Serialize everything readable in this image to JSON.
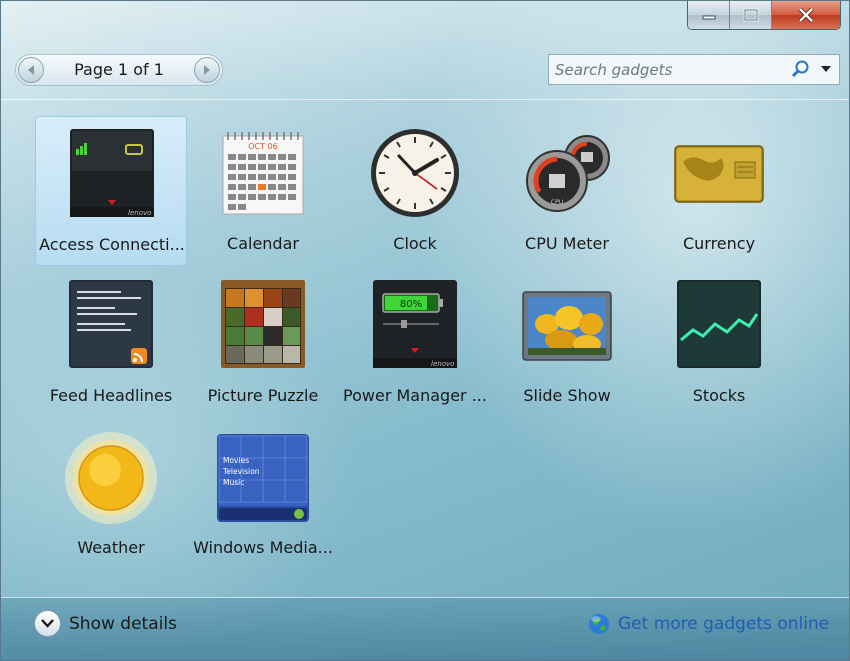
{
  "window_controls": {
    "minimize_glyph": "▁",
    "maximize_glyph": "▢",
    "close_glyph": "✕"
  },
  "pager": {
    "label": "Page 1 of 1",
    "prev_icon": "chevron-left-icon",
    "next_icon": "chevron-right-icon"
  },
  "search": {
    "placeholder": "Search gadgets",
    "icon": "search-icon",
    "dropdown_icon": "dropdown-arrow-icon"
  },
  "gadgets": [
    {
      "label": "Access Connecti...",
      "icon": "access-connections-icon",
      "selected": true
    },
    {
      "label": "Calendar",
      "icon": "calendar-icon",
      "month": "OCT 06"
    },
    {
      "label": "Clock",
      "icon": "clock-icon"
    },
    {
      "label": "CPU Meter",
      "icon": "cpu-meter-icon"
    },
    {
      "label": "Currency",
      "icon": "currency-icon"
    },
    {
      "label": "Feed Headlines",
      "icon": "feed-headlines-icon"
    },
    {
      "label": "Picture Puzzle",
      "icon": "picture-puzzle-icon"
    },
    {
      "label": "Power Manager ...",
      "icon": "power-manager-icon",
      "battery_text": "80%"
    },
    {
      "label": "Slide Show",
      "icon": "slide-show-icon"
    },
    {
      "label": "Stocks",
      "icon": "stocks-icon"
    },
    {
      "label": "Weather",
      "icon": "weather-icon"
    },
    {
      "label": "Windows Media...",
      "icon": "windows-media-center-icon",
      "menu": [
        "Movies",
        "Television",
        "Music"
      ]
    }
  ],
  "footer": {
    "show_details": "Show details",
    "get_more": "Get more gadgets online"
  },
  "colors": {
    "link": "#1f5fb0",
    "selection": "#b9def5",
    "close_button": "#c8452a"
  }
}
